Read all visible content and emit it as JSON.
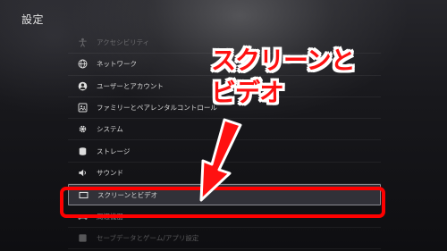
{
  "page_title": "設定",
  "menu": {
    "items": [
      {
        "label": "アクセシビリティ",
        "icon": "accessibility-icon"
      },
      {
        "label": "ネットワーク",
        "icon": "globe-icon"
      },
      {
        "label": "ユーザーとアカウント",
        "icon": "user-icon"
      },
      {
        "label": "ファミリーとペアレンタルコントロール",
        "icon": "family-icon"
      },
      {
        "label": "システム",
        "icon": "gear-icon"
      },
      {
        "label": "ストレージ",
        "icon": "storage-icon"
      },
      {
        "label": "サウンド",
        "icon": "speaker-icon"
      },
      {
        "label": "スクリーンとビデオ",
        "icon": "screen-icon",
        "selected": true
      },
      {
        "label": "周辺機器",
        "icon": "controller-icon"
      },
      {
        "label": "セーブデータとゲーム/アプリ設定",
        "icon": "save-data-icon"
      }
    ]
  },
  "annotation": {
    "callout_line1": "スクリーンと",
    "callout_line2": "ビデオ",
    "color": "#ff1111",
    "outline_color": "#ffffff"
  }
}
